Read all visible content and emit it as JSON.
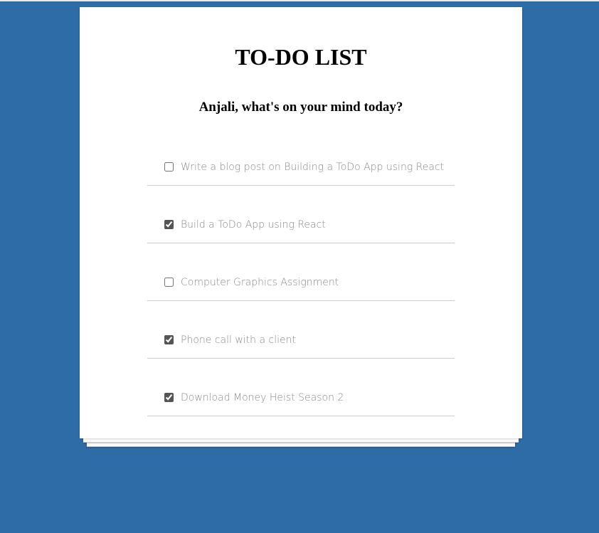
{
  "app": {
    "title": "TO-DO LIST",
    "greeting": "Anjali, what's on your mind today?"
  },
  "todos": [
    {
      "text": "Write a blog post on Building a ToDo App using React",
      "completed": false
    },
    {
      "text": "Build a ToDo App using React",
      "completed": true
    },
    {
      "text": "Computer Graphics Assignment",
      "completed": false
    },
    {
      "text": "Phone call with a client",
      "completed": true
    },
    {
      "text": "Download Money Heist Season 2",
      "completed": true
    }
  ],
  "colors": {
    "background": "#2e6ca8",
    "card": "#ffffff",
    "item_text": "#8a8a8a",
    "divider": "#cccccc"
  }
}
